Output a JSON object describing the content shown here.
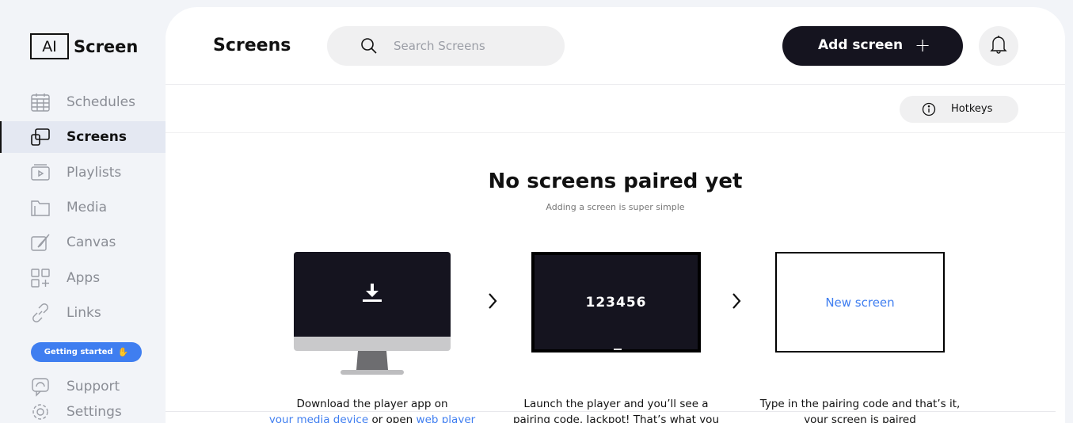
{
  "brand": {
    "logo_mark": "AI",
    "name": "Screen"
  },
  "sidebar": {
    "items": [
      {
        "label": "Schedules",
        "icon": "calendar-icon"
      },
      {
        "label": "Screens",
        "icon": "screens-icon",
        "active": true
      },
      {
        "label": "Playlists",
        "icon": "playlist-icon"
      },
      {
        "label": "Media",
        "icon": "folder-icon"
      },
      {
        "label": "Canvas",
        "icon": "canvas-icon"
      },
      {
        "label": "Apps",
        "icon": "apps-icon"
      },
      {
        "label": "Links",
        "icon": "link-icon"
      }
    ],
    "getting_started": "Getting started",
    "support": "Support",
    "settings": "Settings"
  },
  "header": {
    "title": "Screens",
    "search_placeholder": "Search Screens",
    "add_button": "Add screen",
    "add_plus": "+"
  },
  "subbar": {
    "hotkeys": "Hotkeys"
  },
  "empty": {
    "title": "No screens paired yet",
    "subtitle": "Adding a screen is super simple"
  },
  "steps": {
    "pair_code": "123456",
    "new_screen": "New screen",
    "step1_a": "Download the player app on",
    "step1_link1": "your media device",
    "step1_mid": " or open ",
    "step1_link2": "web player",
    "step2_a": "Launch the player and you’ll see a",
    "step2_b": "pairing code. Jackpot! That’s what you",
    "step3_a": "Type in the pairing code and that’s it,",
    "step3_b": "your screen is paired"
  },
  "colors": {
    "accent": "#3f7ef0",
    "dark": "#15141f",
    "muted": "#8a8d95",
    "active_bg": "#e4e8f2"
  }
}
